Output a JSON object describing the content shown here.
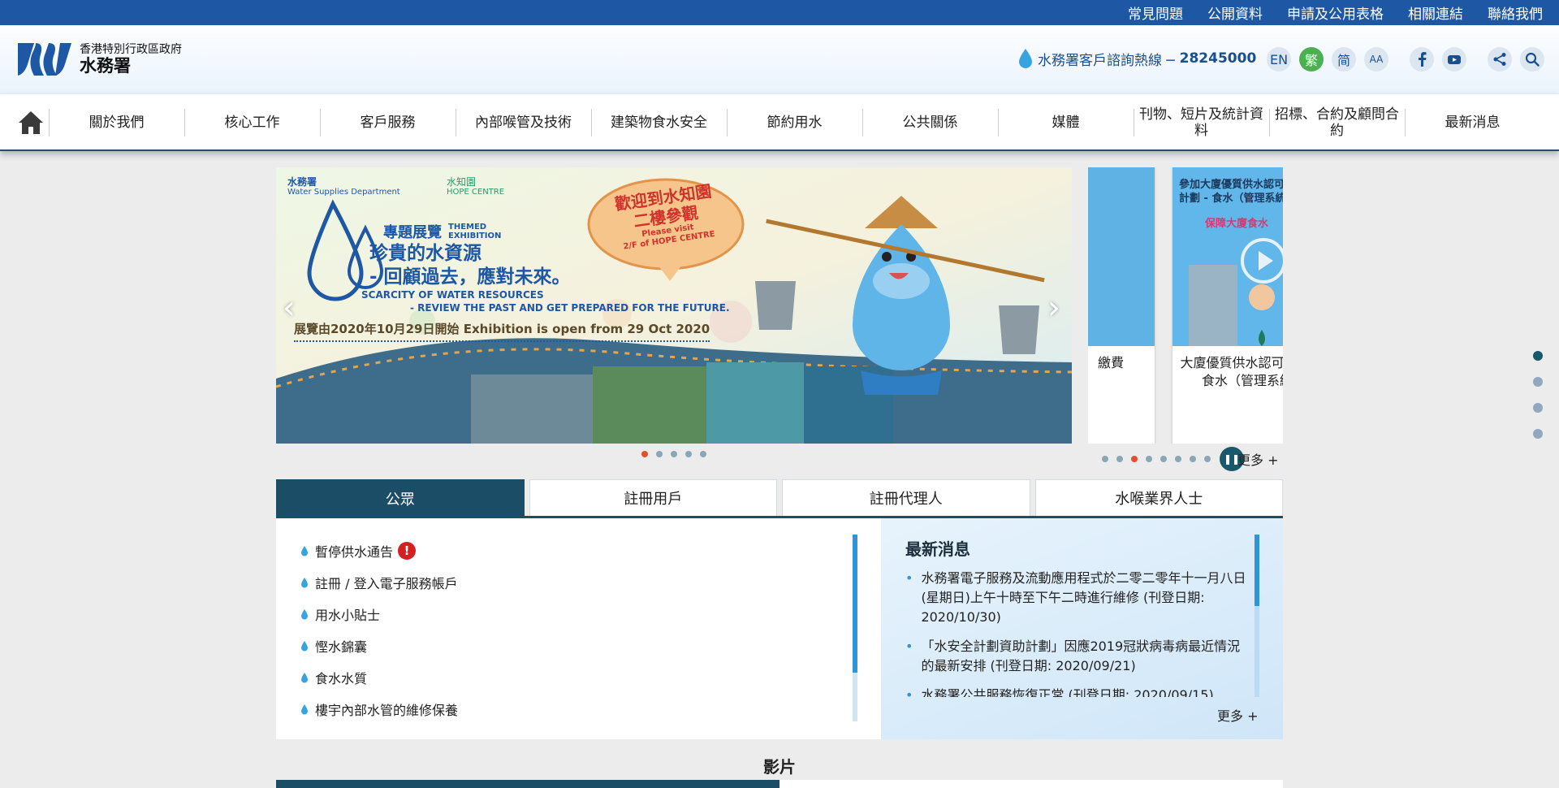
{
  "topbar": {
    "links": [
      "常見問題",
      "公開資料",
      "申請及公用表格",
      "相關連結",
      "聯絡我們"
    ]
  },
  "header": {
    "gov_name": "香港特別行政區政府",
    "dept_name": "水務署",
    "hotline_label": "水務署客戶諮詢熱線 ─",
    "hotline_number": "28245000",
    "lang_en": "EN",
    "lang_tc": "繁",
    "lang_sc": "简",
    "font_size": "AA"
  },
  "nav": {
    "items": [
      "關於我們",
      "核心工作",
      "客戶服務",
      "內部喉管及技術",
      "建築物食水安全",
      "節約用水",
      "公共關係",
      "媒體",
      "刊物、短片及統計資料",
      "招標、合約及顧問合約",
      "最新消息"
    ]
  },
  "banner": {
    "wsd_label": "水務署",
    "wsd_label_en": "Water Supplies Department",
    "hope_label": "水知園",
    "hope_label_en": "HOPE CENTRE",
    "themed": "專題展覽",
    "themed_en": "THEMED EXHIBITION",
    "headline_1": "珍貴的水資源",
    "headline_2": "- 回顧過去，應對未來。",
    "en_1": "SCARCITY OF WATER RESOURCES",
    "en_2": "- REVIEW THE PAST AND GET PREPARED FOR THE FUTURE.",
    "open_date": "展覽由2020年10月29日開始 Exhibition is open from 29 Oct 2020",
    "bubble_1": "歡迎到水知園",
    "bubble_2": "二樓參觀",
    "bubble_en_1": "Please visit",
    "bubble_en_2": "2/F of HOPE CENTRE",
    "slide_count": 5,
    "active_slide": 1
  },
  "side_carousel": {
    "card1_caption": "繳費",
    "card2_caption": "大廈優質供水認可計劃 — 食水（管理系統）",
    "card2_header": "參加大廈優質供水認可計劃 - 食水（管理系統）",
    "card2_sub": "保障大廈食水",
    "dot_count": 8,
    "active_dot": 3,
    "more": "更多 +"
  },
  "tabs": [
    "公眾",
    "註冊用戶",
    "註冊代理人",
    "水喉業界人士"
  ],
  "public_links": [
    "暫停供水通告",
    "註冊 / 登入電子服務帳戶",
    "用水小貼士",
    "慳水錦囊",
    "食水水質",
    "樓宇內部水管的維修保養"
  ],
  "news": {
    "title": "最新消息",
    "items": [
      "水務署電子服務及流動應用程式於二零二零年十一月八日(星期日)上午十時至下午二時進行維修 (刊登日期: 2020/10/30)",
      "「水安全計劃資助計劃」因應2019冠狀病毒病最近情況的最新安排 (刊登日期: 2020/09/21)",
      "水務署公共服務恢復正常 (刊登日期: 2020/09/15)"
    ],
    "more": "更多 +"
  },
  "video": {
    "title": "影片"
  },
  "colors": {
    "primary": "#1e57a4",
    "teal": "#1c4d66",
    "accent": "#2f95d8",
    "alert": "#d32020"
  }
}
